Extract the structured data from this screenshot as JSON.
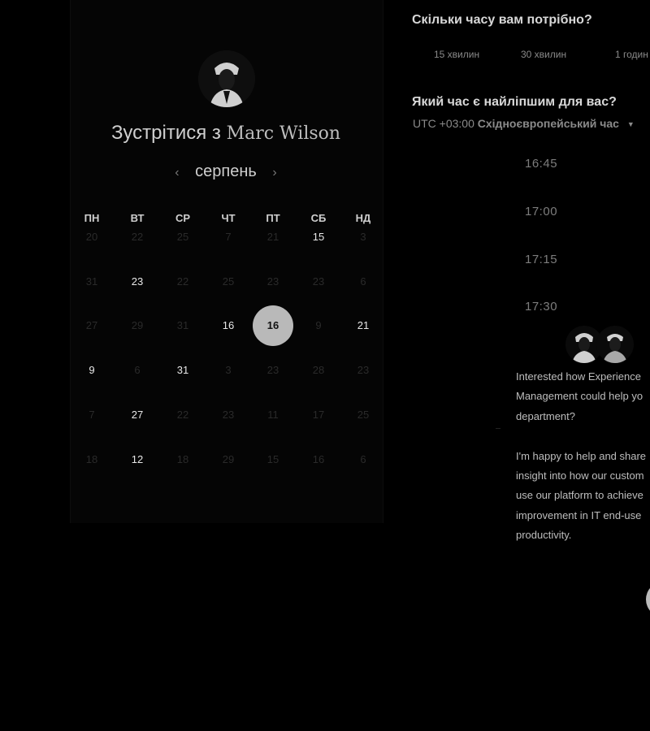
{
  "calendar": {
    "title_prefix": "Зустрітися з",
    "host_name": "Marc Wilson",
    "month": "серпень",
    "prev_icon": "chevron-left-icon",
    "next_icon": "chevron-right-icon",
    "weekdays": [
      "ПН",
      "ВТ",
      "СР",
      "ЧТ",
      "ПТ",
      "СБ",
      "НД"
    ],
    "weeks": [
      [
        "20",
        "22",
        "25",
        "7",
        "21",
        "15",
        "3"
      ],
      [
        "31",
        "23",
        "22",
        "25",
        "23",
        "23",
        "6"
      ],
      [
        "27",
        "29",
        "31",
        "16",
        "16",
        "9",
        "21"
      ],
      [
        "9",
        "6",
        "31",
        "3",
        "23",
        "28",
        "23"
      ],
      [
        "7",
        "27",
        "22",
        "23",
        "11",
        "17",
        "25"
      ],
      [
        "18",
        "12",
        "18",
        "29",
        "15",
        "16",
        "6"
      ]
    ],
    "available": [
      [
        0,
        5
      ],
      [
        1,
        1
      ],
      [
        2,
        3
      ],
      [
        2,
        6
      ],
      [
        3,
        0
      ],
      [
        3,
        2
      ],
      [
        4,
        1
      ],
      [
        5,
        1
      ]
    ],
    "selected": [
      2,
      4
    ]
  },
  "duration": {
    "question": "Скільки часу вам потрібно?",
    "options": [
      "15 хвилин",
      "30 хвилин",
      "1 годин"
    ]
  },
  "time": {
    "question": "Який час є найліпшим для вас?",
    "timezone_offset": "UTC +03:00",
    "timezone_name": "Східноєвропейський час",
    "slots": [
      "16:45",
      "17:00",
      "17:15",
      "17:30"
    ]
  },
  "chat": {
    "message_lines": [
      "Interested how Experience",
      "Management could help yo",
      "department?",
      "",
      "I'm happy to help and share",
      "insight into how our custom",
      "use our platform to achieve",
      "improvement in IT end-use",
      "productivity."
    ]
  }
}
